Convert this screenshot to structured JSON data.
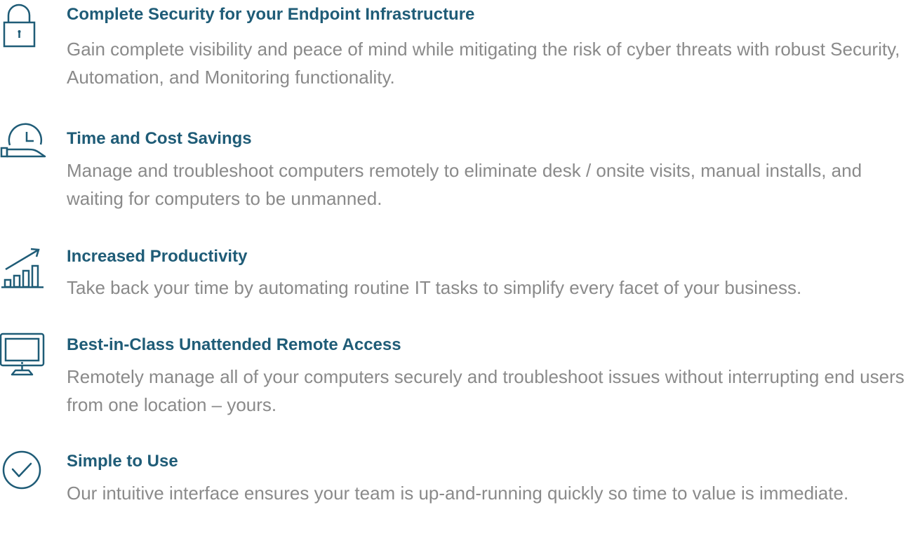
{
  "colors": {
    "title": "#1f5c77",
    "description": "#8a8a8a",
    "icon": "#1f5c77",
    "background": "#ffffff"
  },
  "features": [
    {
      "icon": "lock-icon",
      "title": "Complete Security for your Endpoint Infrastructure",
      "description": "Gain complete visibility and peace of mind while mitigating the risk of cyber threats with robust Security, Automation, and Monitoring functionality."
    },
    {
      "icon": "clock-hand-icon",
      "title": "Time and Cost Savings",
      "description": "Manage and troubleshoot computers remotely to eliminate desk / onsite visits, manual installs, and waiting for computers to be unmanned."
    },
    {
      "icon": "growth-chart-icon",
      "title": "Increased Productivity",
      "description": "Take back your time by automating routine IT tasks to simplify every facet of your business."
    },
    {
      "icon": "monitor-icon",
      "title": "Best-in-Class Unattended Remote Access",
      "description": "Remotely manage all of your computers securely and troubleshoot issues without interrupting end users from one location – yours."
    },
    {
      "icon": "checkmark-circle-icon",
      "title": "Simple to Use",
      "description": "Our intuitive interface ensures your team is up-and-running quickly so time to value is immediate."
    }
  ]
}
